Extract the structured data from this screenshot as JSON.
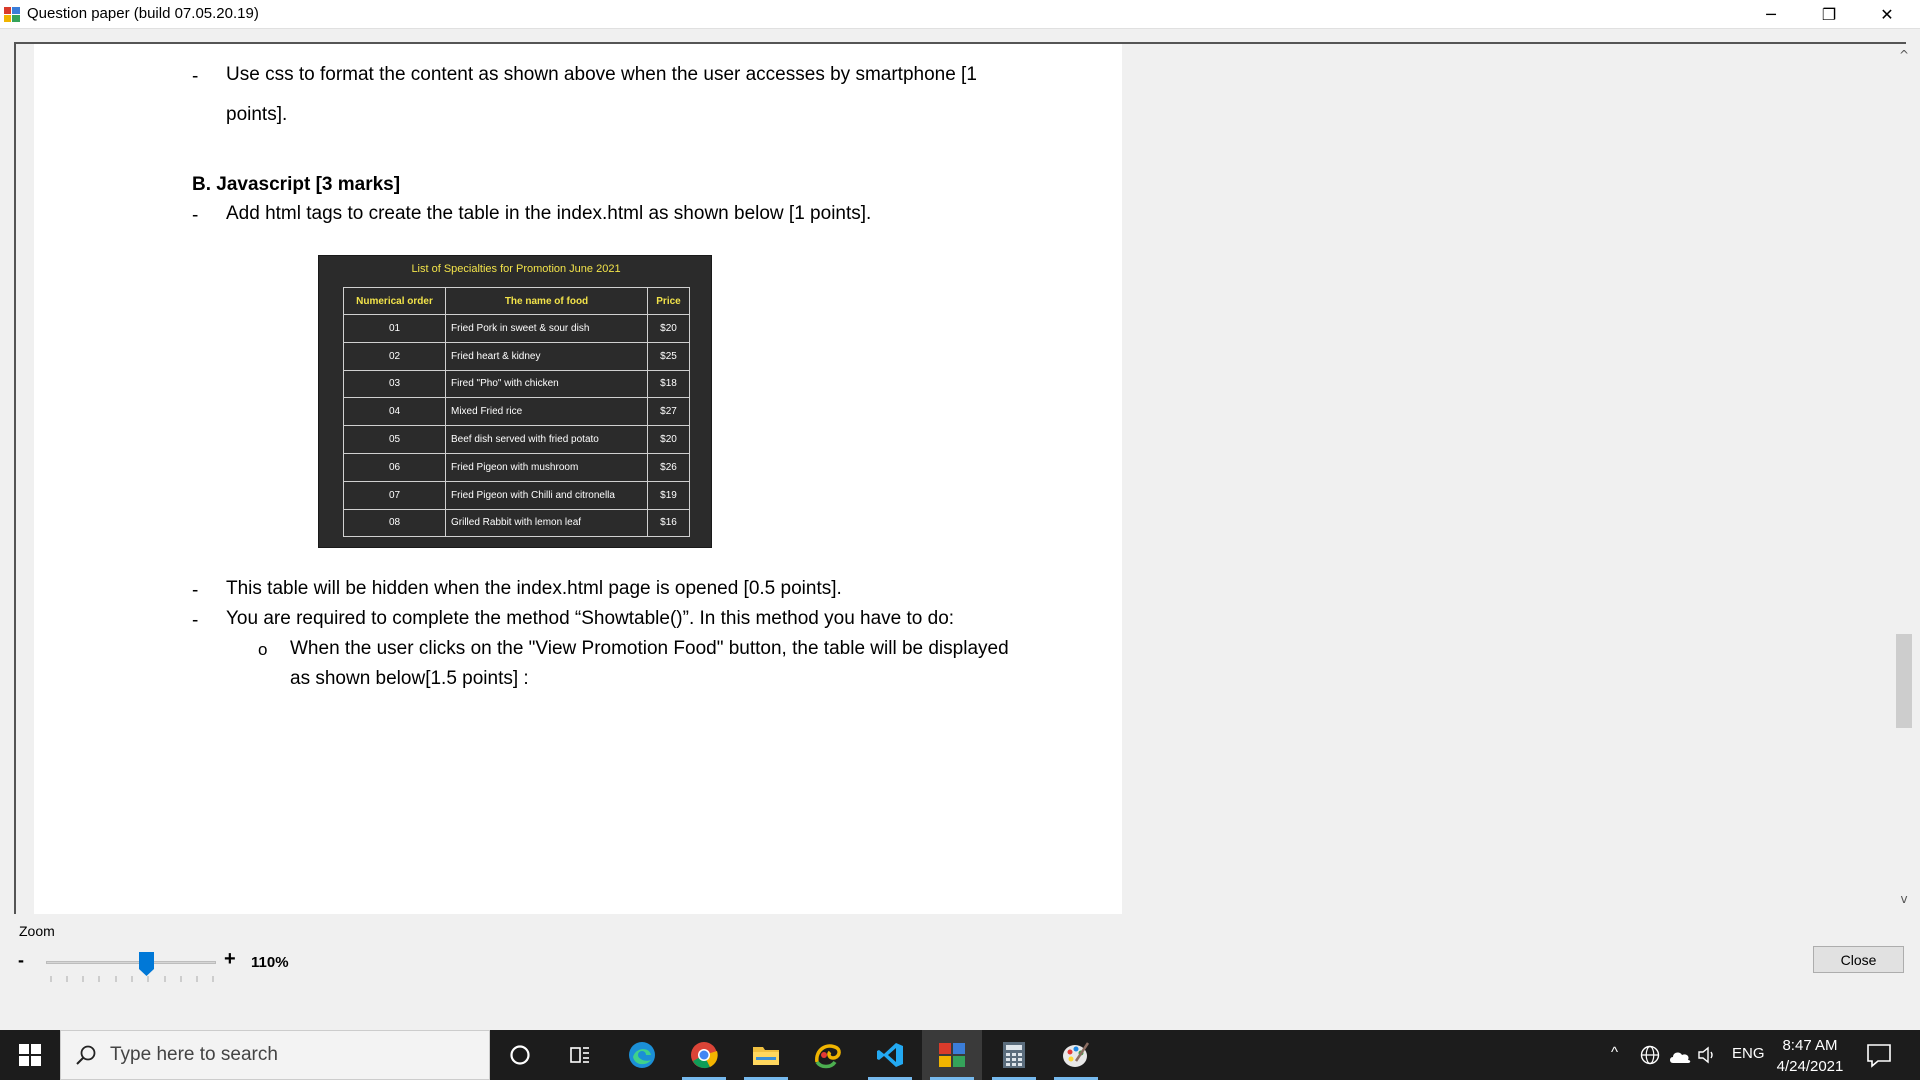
{
  "window": {
    "title": "Question paper (build 07.05.20.19)",
    "minimize": "─",
    "restore": "❐",
    "close": "✕"
  },
  "document": {
    "dash": "-",
    "line1": "Use css to format the content as shown above when the user accesses by smartphone [1",
    "line2": "points].",
    "heading": "B.   Javascript [3 marks]",
    "line3": "Add html tags to create the table in the index.html as shown below  [1 points].",
    "line4": "This table will be hidden when the index.html page is opened [0.5 points].",
    "line5": "You are required to complete the method “Showtable()”. In this method you have to do:",
    "sub_bullet": "o",
    "line6": "When the user clicks on the \"View Promotion Food\" button, the table will be displayed",
    "line7": "as shown below[1.5 points] :"
  },
  "figure": {
    "title": "List of Specialties for Promotion June 2021",
    "headers": [
      "Numerical order",
      "The name of food",
      "Price"
    ],
    "rows": [
      [
        "01",
        "Fried Pork in sweet & sour dish",
        "$20"
      ],
      [
        "02",
        "Fried heart & kidney",
        "$25"
      ],
      [
        "03",
        "Fired \"Pho\" with chicken",
        "$18"
      ],
      [
        "04",
        "Mixed Fried rice",
        "$27"
      ],
      [
        "05",
        "Beef dish served with fried potato",
        "$20"
      ],
      [
        "06",
        "Fried Pigeon with mushroom",
        "$26"
      ],
      [
        "07",
        "Fried Pigeon with Chilli and citronella",
        "$19"
      ],
      [
        "08",
        "Grilled Rabbit with lemon leaf",
        "$16"
      ]
    ],
    "header_color": "#f2e34a",
    "background": "#2b2b2b"
  },
  "scrollbar": {
    "up": "^",
    "down": "v",
    "position": 0.62
  },
  "zoom": {
    "label": "Zoom",
    "minus": "-",
    "plus": "+",
    "value": "110%",
    "slider_level": 0.5
  },
  "buttons": {
    "close": "Close"
  },
  "taskbar": {
    "search_placeholder": "Type here to search",
    "apps": [
      "cortana-icon",
      "task-view-icon",
      "edge-icon",
      "chrome-icon",
      "file-explorer-icon",
      "snagit-icon",
      "vscode-icon",
      "question-paper-icon",
      "calculator-icon",
      "paint-icon"
    ],
    "language": "ENG",
    "time": "8:47 AM",
    "date": "4/24/2021",
    "tray_chevron": "^"
  }
}
